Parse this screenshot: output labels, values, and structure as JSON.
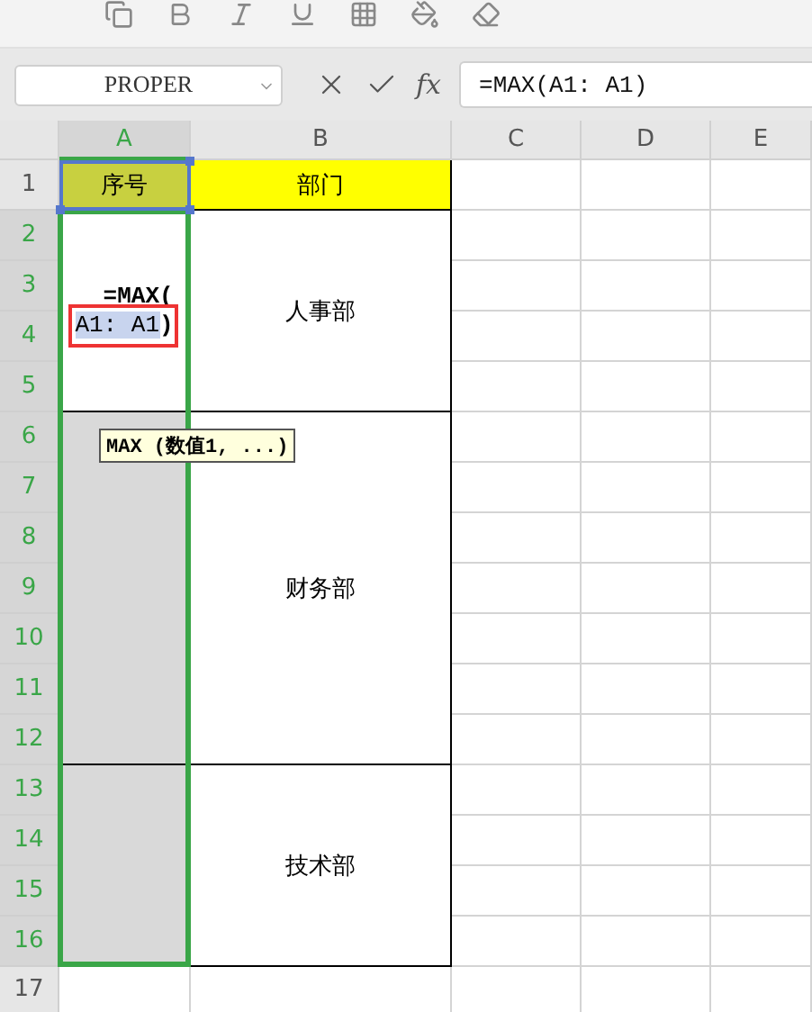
{
  "name_box": {
    "value": "PROPER"
  },
  "formula_bar": {
    "fx": "fx",
    "value": "=MAX(A1: A1)"
  },
  "columns": [
    {
      "label": "A",
      "selected": true
    },
    {
      "label": "B",
      "selected": false
    },
    {
      "label": "C",
      "selected": false
    },
    {
      "label": "D",
      "selected": false
    },
    {
      "label": "E",
      "selected": false
    }
  ],
  "rows": [
    {
      "label": "1",
      "selected": false
    },
    {
      "label": "2",
      "selected": true
    },
    {
      "label": "3",
      "selected": true
    },
    {
      "label": "4",
      "selected": true
    },
    {
      "label": "5",
      "selected": true
    },
    {
      "label": "6",
      "selected": true
    },
    {
      "label": "7",
      "selected": true
    },
    {
      "label": "8",
      "selected": true
    },
    {
      "label": "9",
      "selected": true
    },
    {
      "label": "10",
      "selected": true
    },
    {
      "label": "11",
      "selected": true
    },
    {
      "label": "12",
      "selected": true
    },
    {
      "label": "13",
      "selected": true
    },
    {
      "label": "14",
      "selected": true
    },
    {
      "label": "15",
      "selected": true
    },
    {
      "label": "16",
      "selected": true
    },
    {
      "label": "17",
      "selected": false
    }
  ],
  "header_cells": [
    {
      "text": "序号",
      "color": "#c8d040"
    },
    {
      "text": "部门",
      "color": "#ffff00"
    }
  ],
  "editing_cell": {
    "line_1": "=MAX(",
    "reference": "A1: A1",
    "line_end": ")"
  },
  "tooltip": "MAX (数值1, ...)",
  "departments": [
    {
      "name": "人事部"
    },
    {
      "name": "财务部"
    },
    {
      "name": "技术部"
    }
  ]
}
